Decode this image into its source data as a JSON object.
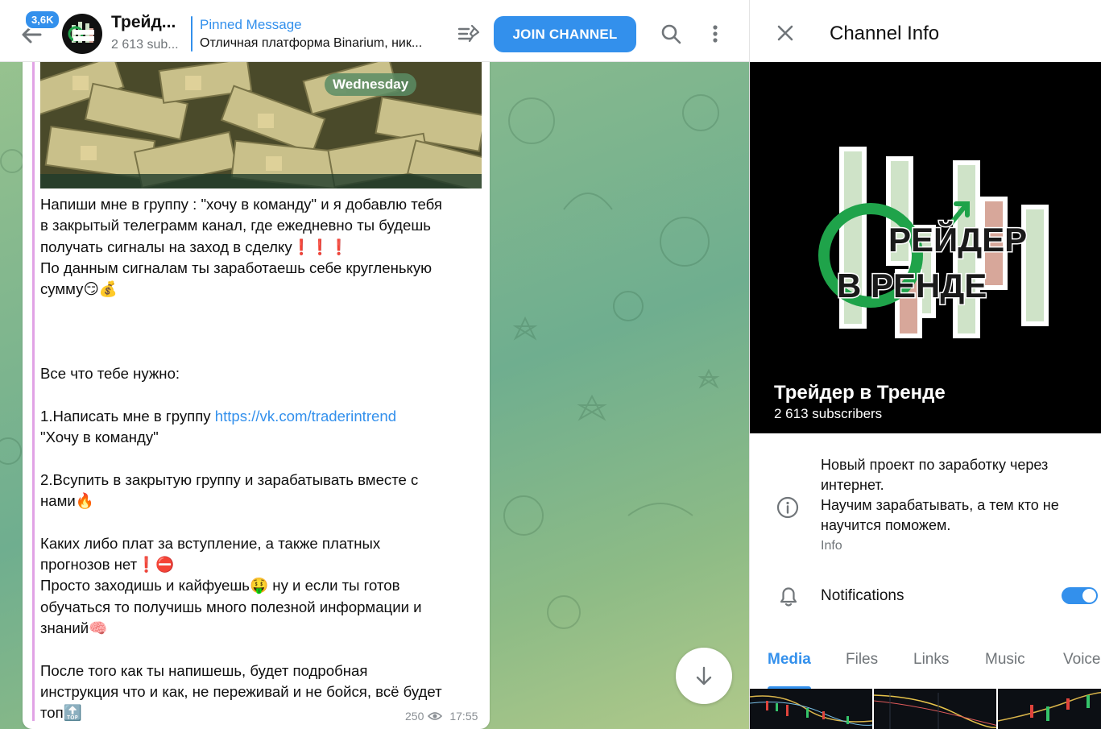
{
  "header": {
    "unread_badge": "3,6K",
    "channel_title": "Трейд...",
    "channel_subs": "2 613 sub...",
    "pinned_title": "Pinned Message",
    "pinned_text": "Отличная платформа Binarium, ник...",
    "join_label": "JOIN CHANNEL"
  },
  "message": {
    "date_label": "Wednesday",
    "text_part1": "Напиши мне в группу : \"хочу в команду\" и я добавлю тебя\nв закрытый телеграмм канал, где ежедневно ты будешь\nполучать сигналы на заход в сделку❗❗❗\nПо данным сигналам ты заработаешь себе кругленькую\nсумму😏💰\n\n\n\nВсе что тебе нужно:\n\n1.Написать мне в группу ",
    "link": "https://vk.com/traderintrend",
    "text_part2": "\n\"Хочу в команду\"\n\n2.Всупить в закрытую группу и зарабатывать вместе с\nнами🔥\n\nКаких либо плат за вступление, а также платных\nпрогнозов нет❗⛔\nПросто заходишь и кайфуешь🤑 ну и если ты готов\nобучаться то получишь много полезной информации и\nзнаний🧠\n\nПосле того как ты напишешь, будет подробная\nинструкция что и как, не переживай и не бойся, всё будет\nтоп🔝",
    "views": "250",
    "time": "17:55"
  },
  "info_panel": {
    "title": "Channel Info",
    "channel_name": "Трейдер в Тренде",
    "subscribers": "2 613 subscribers",
    "about": "Новый проект по заработку через\nинтернет.\nНаучим зарабатывать, а тем кто не\nнаучится поможем.",
    "about_label": "Info",
    "notifications_label": "Notifications",
    "notifications_on": true,
    "tabs": [
      "Media",
      "Files",
      "Links",
      "Music",
      "Voice"
    ],
    "logo_text_line1": "РЕЙДЕР",
    "logo_text_line2": "В РЕНДЕ"
  },
  "colors": {
    "accent": "#3390ec",
    "chat_bg": "#86b98e",
    "quote_bar": "#e1a3e5"
  }
}
